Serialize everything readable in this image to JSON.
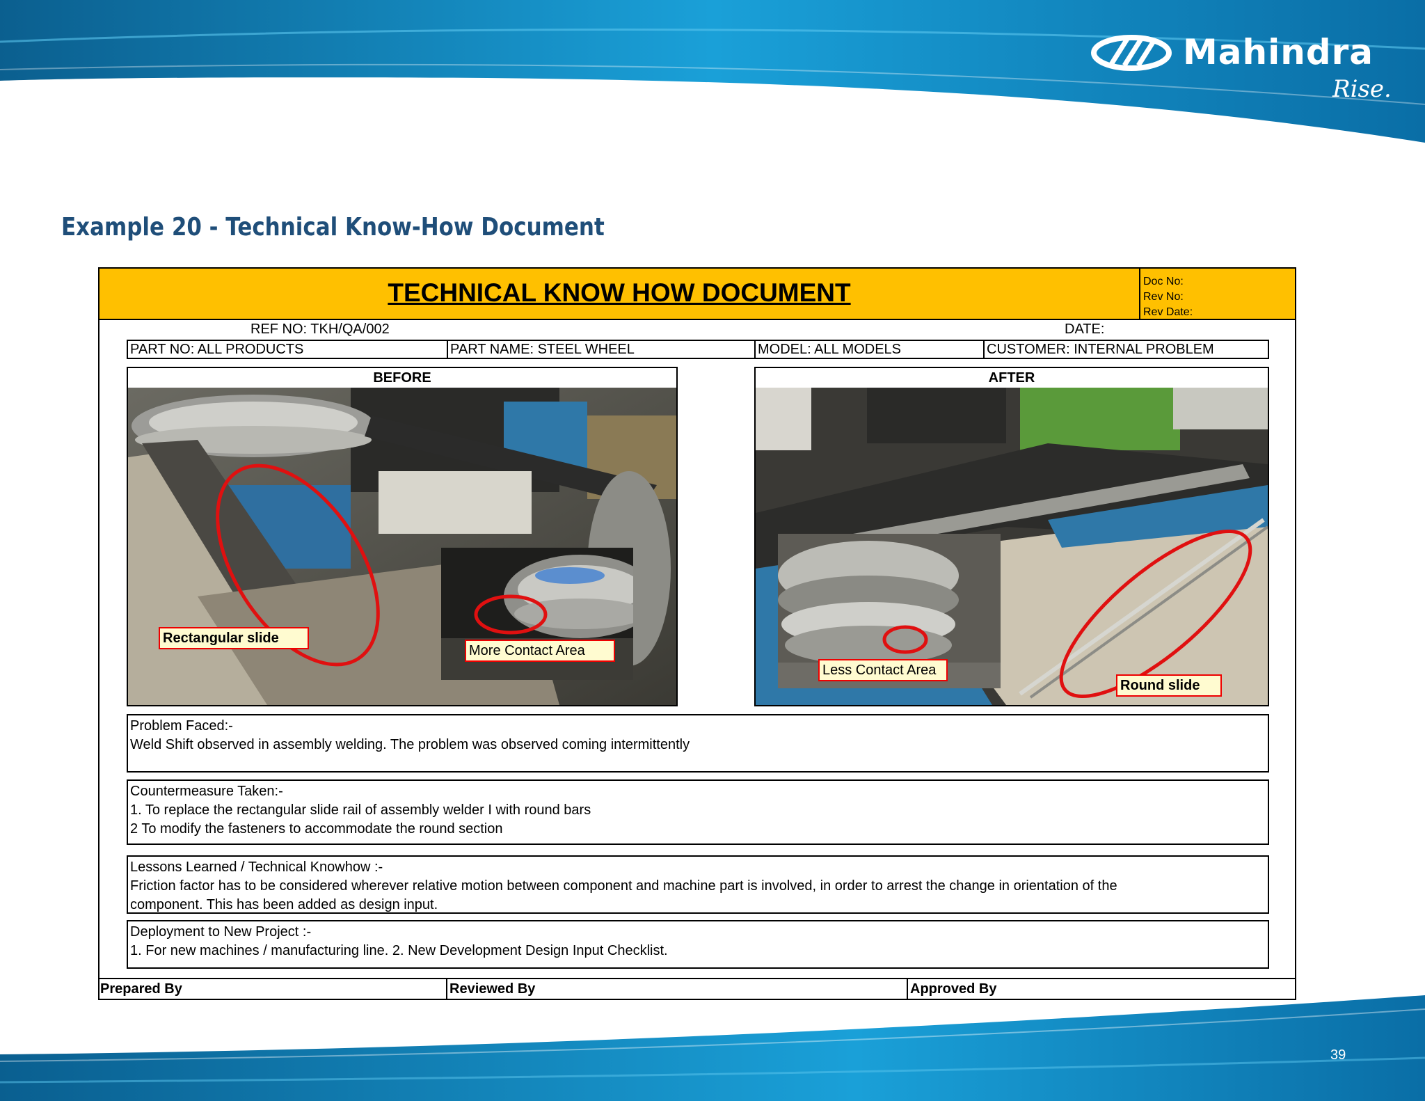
{
  "brand": {
    "name": "Mahindra",
    "tagline": "Rise."
  },
  "page": {
    "title": "Example 20 - Technical Know-How Document",
    "number": "39"
  },
  "document": {
    "title": "TECHNICAL KNOW HOW DOCUMENT",
    "doc_no_label": "Doc No:",
    "rev_no_label": "Rev No:",
    "rev_date_label": "Rev Date:",
    "ref_no": "REF NO: TKH/QA/002",
    "date_label": "DATE:",
    "part_no": "PART NO: ALL PRODUCTS",
    "part_name": "PART NAME: STEEL WHEEL",
    "model": "MODEL: ALL MODELS",
    "customer": "CUSTOMER: INTERNAL PROBLEM",
    "before": {
      "label": "BEFORE",
      "callouts": [
        "Rectangular slide",
        "More Contact Area"
      ]
    },
    "after": {
      "label": "AFTER",
      "callouts": [
        "Less Contact Area",
        "Round slide"
      ]
    },
    "problem": {
      "heading": "Problem Faced:-",
      "text": "Weld Shift observed in assembly welding. The problem was observed coming intermittently"
    },
    "countermeasure": {
      "heading": "Countermeasure Taken:-",
      "line1": "1. To replace the rectangular slide rail of assembly welder I with round bars",
      "line2": "2  To modify the fasteners to accommodate the round section"
    },
    "lessons": {
      "heading": "Lessons Learned / Technical Knowhow :-",
      "line1": "Friction factor has to be considered wherever relative motion between component and machine part is involved, in order to arrest the change in orientation of the",
      "line2": "component. This has been added as design input."
    },
    "deployment": {
      "heading": "Deployment to New Project :-",
      "text": "1. For new machines / manufacturing line. 2. New Development Design Input Checklist."
    },
    "prepared_by": "Prepared By",
    "reviewed_by": "Reviewed By",
    "approved_by": "Approved By"
  },
  "colors": {
    "banner_blue": "#0a7fb8",
    "header_yellow": "#ffc000",
    "title_blue": "#1f4e79",
    "callout_red": "#e00000"
  }
}
